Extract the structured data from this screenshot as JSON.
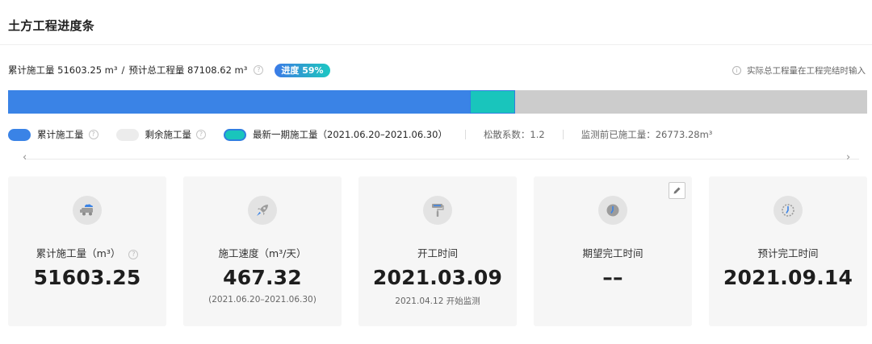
{
  "title": "土方工程进度条",
  "summary": {
    "cumulative_text": "累计施工量 51603.25 m³",
    "separator": "/",
    "total_text": "预计总工程量 87108.62 m³",
    "help_symbol": "?",
    "progress_label": "进度 59%",
    "progress_fraction": 0.59
  },
  "note": {
    "info_symbol": "i",
    "text": "实际总工程量在工程完结时输入"
  },
  "bar": {
    "cumulative_fraction": 0.59,
    "latest_start_fraction": 0.538,
    "latest_end_fraction": 0.59,
    "colors": {
      "cumulative": "#3a83e6",
      "latest": "#19c5bc",
      "remaining": "#cccccc"
    }
  },
  "legend": {
    "cumulative_label": "累计施工量",
    "remaining_label": "剩余施工量",
    "latest_label": "最新一期施工量（2021.06.20–2021.06.30）",
    "help_symbol": "?",
    "loose_coef": "松散系数：1.2",
    "pre_monitor": "监测前已施工量：26773.28m³"
  },
  "nav": {
    "left": "‹",
    "right": "›"
  },
  "cards": [
    {
      "icon": "truck-icon",
      "label": "累计施工量（m³）",
      "help_symbol": "?",
      "value": "51603.25",
      "sub": ""
    },
    {
      "icon": "rocket-icon",
      "label": "施工速度（m³/天）",
      "value": "467.32",
      "sub": "(2021.06.20–2021.06.30)"
    },
    {
      "icon": "paint-roller-icon",
      "label": "开工时间",
      "value": "2021.03.09",
      "sub": "2021.04.12 开始监测"
    },
    {
      "icon": "clock-icon",
      "label": "期望完工时间",
      "value": "––",
      "sub": ""
    },
    {
      "icon": "clock-dashed-icon",
      "label": "预计完工时间",
      "value": "2021.09.14",
      "sub": ""
    }
  ]
}
